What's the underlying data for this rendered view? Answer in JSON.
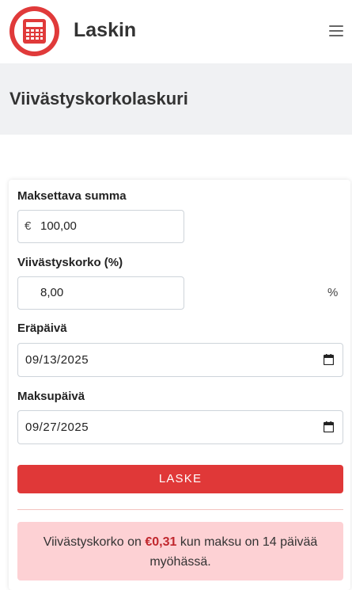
{
  "header": {
    "app_title": "Laskin",
    "logo_icon": "calculator-icon",
    "menu_icon": "hamburger-menu-icon",
    "brand_color": "#e03a3a"
  },
  "page": {
    "title": "Viivästyskorkolaskuri"
  },
  "form": {
    "amount": {
      "label": "Maksettava summa",
      "prefix": "€",
      "value": "100,00"
    },
    "rate": {
      "label": "Viivästyskorko (%)",
      "value": "8,00",
      "suffix": "%"
    },
    "due_date": {
      "label": "Eräpäivä",
      "value": "09/13/2025",
      "icon": "calendar-icon"
    },
    "pay_date": {
      "label": "Maksupäivä",
      "value": "09/27/2025",
      "icon": "calendar-icon"
    },
    "submit_label": "LASKE",
    "submit_color": "#e03838"
  },
  "result": {
    "text_before": "Viivästyskorko on",
    "amount": "€0,31",
    "text_after": "kun maksu on 14 päivää myöhässä.",
    "background": "#fdd1d4"
  }
}
